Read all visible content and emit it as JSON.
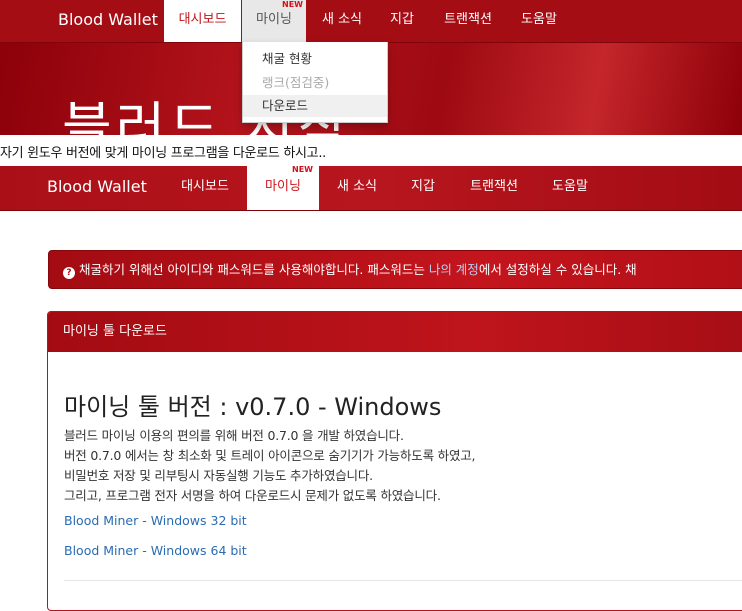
{
  "top_nav": {
    "brand": "Blood Wallet",
    "items": [
      {
        "label": "대시보드"
      },
      {
        "label": "마이닝",
        "badge": "NEW"
      },
      {
        "label": "새 소식"
      },
      {
        "label": "지갑"
      },
      {
        "label": "트랜잭션"
      },
      {
        "label": "도움말"
      }
    ],
    "dropdown": [
      {
        "label": "채굴 현황"
      },
      {
        "label": "랭크(점검중)"
      },
      {
        "label": "다운로드"
      }
    ]
  },
  "hero": {
    "heading": "블러드 시작"
  },
  "caption": "자기 윈도우 버전에 맞게 마이닝 프로그램을 다운로드 하시고..",
  "main_nav": {
    "brand": "Blood Wallet",
    "items": [
      {
        "label": "대시보드"
      },
      {
        "label": "마이닝",
        "badge": "NEW"
      },
      {
        "label": "새 소식"
      },
      {
        "label": "지갑"
      },
      {
        "label": "트랜잭션"
      },
      {
        "label": "도움말"
      }
    ]
  },
  "alert": {
    "text_before": "채굴하기 위해선 아이디와 패스워드를 사용해야합니다. 패스워드는 ",
    "link_text": "나의 계정",
    "text_after": "에서 설정하실 수 있습니다. 채"
  },
  "panel": {
    "header": "마이닝 툴 다운로드",
    "title": "마이닝 툴 버전 : v0.7.0 - Windows",
    "description": [
      "블러드 마이닝 이용의 편의를 위해 버전 0.7.0 을 개발 하였습니다.",
      "버전 0.7.0 에서는 창 최소화 및 트레이 아이콘으로 숨기기가 가능하도록 하였고,",
      "비밀번호 저장 및 리부팅시 자동실행 기능도 추가하였습니다.",
      "그리고, 프로그램 전자 서명을 하여 다운로드시 문제가 없도록 하였습니다."
    ],
    "links": [
      {
        "label": "Blood Miner - Windows 32 bit"
      },
      {
        "label": "Blood Miner - Windows 64 bit"
      }
    ]
  },
  "colors": {
    "brand_red": "#b5141c",
    "link_blue": "#2a6cb3",
    "alert_link": "#b5cff5"
  }
}
